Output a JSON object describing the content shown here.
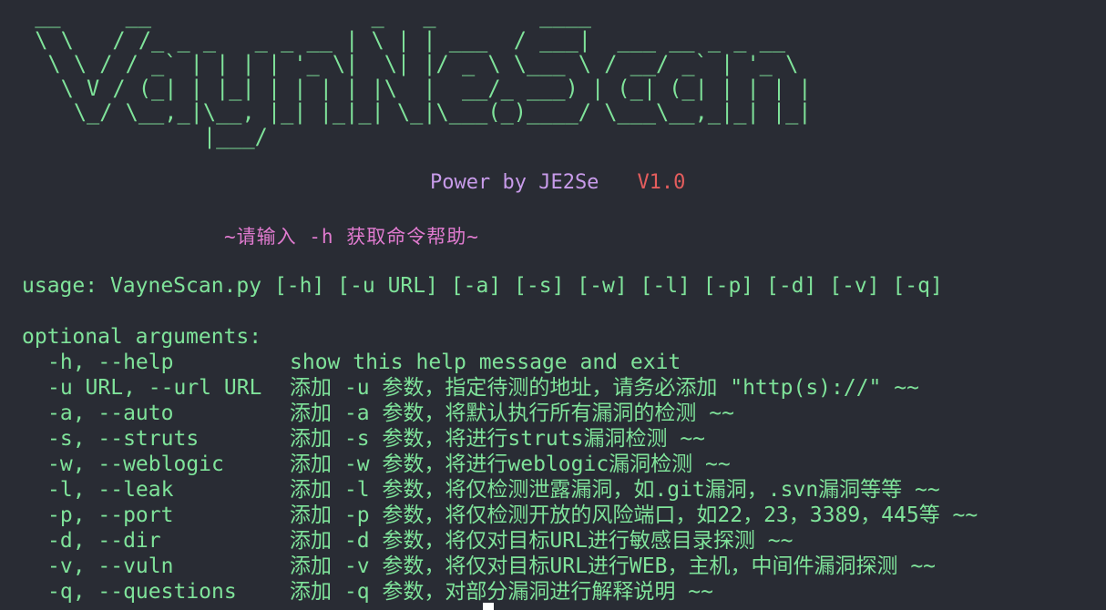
{
  "banner": " __     __                 _   _        ____\n \\ \\   / /_ _ _   _ _ __ | \\ | | ___  / ___|  ___ __ _ _ __\n  \\ \\ / / _` | | | | '_ \\|  \\| |/ _ \\ \\___ \\ / __/ _` | '_ \\\n   \\ V / (_| | |_| | | | | |\\  |  __/_ ___) | (_| (_| | | | |\n    \\_/ \\__,_|\\__, |_| |_|_| \\_|\\___(_)____/ \\___\\__,_|_| |_|\n              |___/",
  "power": {
    "author": "Power by JE2Se",
    "version": "V1.0"
  },
  "hint": "~请输入 -h 获取命令帮助~",
  "usage": "usage: VayneScan.py [-h] [-u URL] [-a] [-s] [-w] [-l] [-p] [-d] [-v] [-q]",
  "optional_heading": "optional arguments:",
  "options": [
    {
      "flag": "-h, --help",
      "desc": "show this help message and exit"
    },
    {
      "flag": "-u URL, --url URL",
      "desc": "添加 -u 参数，指定待测的地址，请务必添加 \"http(s)://\" ~~"
    },
    {
      "flag": "-a, --auto",
      "desc": "添加 -a 参数，将默认执行所有漏洞的检测 ~~"
    },
    {
      "flag": "-s, --struts",
      "desc": "添加 -s 参数，将进行struts漏洞检测 ~~"
    },
    {
      "flag": "-w, --weblogic",
      "desc": "添加 -w 参数，将进行weblogic漏洞检测 ~~"
    },
    {
      "flag": "-l, --leak",
      "desc": "添加 -l 参数，将仅检测泄露漏洞，如.git漏洞，.svn漏洞等等 ~~"
    },
    {
      "flag": "-p, --port",
      "desc": "添加 -p 参数，将仅检测开放的风险端口，如22，23，3389，445等 ~~"
    },
    {
      "flag": "-d, --dir",
      "desc": "添加 -d 参数，将仅对目标URL进行敏感目录探测 ~~"
    },
    {
      "flag": "-v, --vuln",
      "desc": "添加 -v 参数，将仅对目标URL进行WEB，主机，中间件漏洞探测 ~~"
    },
    {
      "flag": "-q, --questions",
      "desc": "添加 -q 参数，对部分漏洞进行解释说明 ~~"
    }
  ],
  "colors": {
    "background": "#292c34",
    "text": "#7fe39a",
    "author": "#c89bea",
    "version": "#e45d5d",
    "hint": "#e07bcf"
  }
}
